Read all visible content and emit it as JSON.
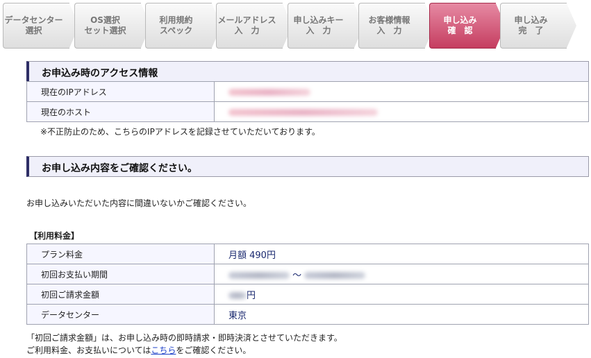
{
  "steps": [
    {
      "line1": "データセンター",
      "line2": "選択"
    },
    {
      "line1": "OS選択",
      "line2": "セット選択"
    },
    {
      "line1": "利用規約",
      "line2": "スペック"
    },
    {
      "line1": "メールアドレス",
      "line2": "入　力"
    },
    {
      "line1": "申し込みキー",
      "line2": "入　力"
    },
    {
      "line1": "お客様情報",
      "line2": "入　力"
    },
    {
      "line1": "申し込み",
      "line2": "確　認"
    },
    {
      "line1": "申し込み",
      "line2": "完　了"
    }
  ],
  "access": {
    "title": "お申込み時のアクセス情報",
    "ip_label": "現在のIPアドレス",
    "host_label": "現在のホスト",
    "note": "※不正防止のため、こちらのIPアドレスを記録させていただいております。"
  },
  "confirm": {
    "title": "お申し込み内容をご確認ください。",
    "intro": "お申し込みいただいた内容に間違いないかご確認ください。"
  },
  "fees": {
    "heading": "【利用料金】",
    "plan_label": "プラン料金",
    "plan_value": "月額 490円",
    "period_label": "初回お支払い期間",
    "period_sep": "〜",
    "amount_label": "初回ご請求金額",
    "amount_unit": "円",
    "dc_label": "データセンター",
    "dc_value": "東京"
  },
  "footer": {
    "line1": "「初回ご請求金額」は、お申し込み時の即時請求・即時決済とさせていただきます。",
    "line2_pre": "ご利用料金、お支払いについては",
    "link": "こちら",
    "line2_post": "をご確認ください。"
  },
  "colors": {
    "active_step": "#c53d60",
    "section_accent": "#2e2e66",
    "label_bg": "#f6f6ff",
    "link": "#1a3ec8"
  }
}
